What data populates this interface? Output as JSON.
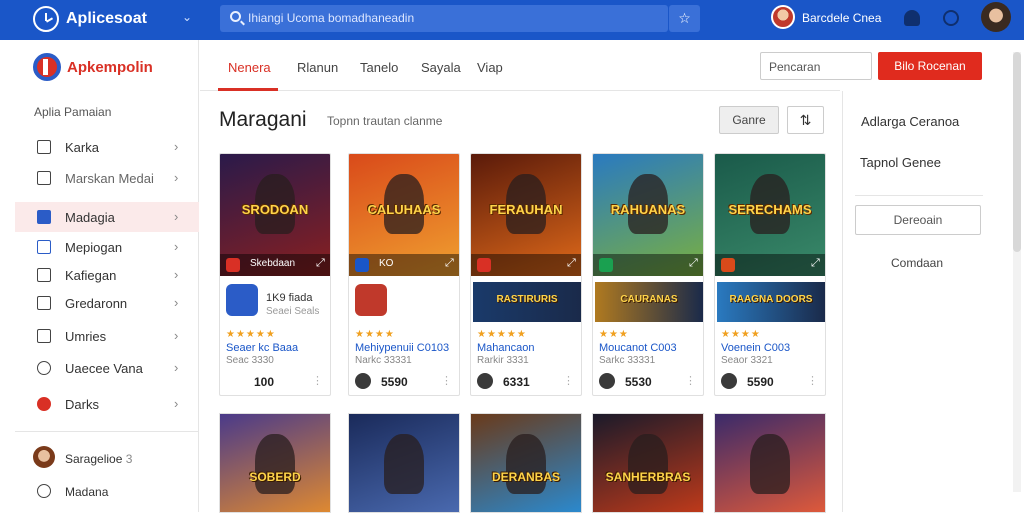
{
  "topbar": {
    "app_title": "Aplicesoat",
    "search_placeholder": "Ihiangi Ucoma bomadhaneadin",
    "user_name": "Barcdele Cnea"
  },
  "sidebar": {
    "brand": "Apkempolin",
    "section_title": "Aplia Pamaian",
    "items": [
      {
        "label": "Karka",
        "icon": "document-icon"
      },
      {
        "label": "Marskan Medai",
        "icon": "square-icon"
      },
      {
        "label": "Madagia",
        "icon": "star-icon",
        "active": true
      },
      {
        "label": "Mepiogan",
        "icon": "list-icon"
      },
      {
        "label": "Kafiegan",
        "icon": "square-icon"
      },
      {
        "label": "Gredaronn",
        "icon": "folder-icon"
      },
      {
        "label": "Umries",
        "icon": "chart-icon"
      },
      {
        "label": "Uaecee Vana",
        "icon": "refresh-icon"
      },
      {
        "label": "Darks",
        "icon": "flag-icon"
      }
    ],
    "user": "Saragelioe",
    "user_badge": "3",
    "last_item": "Madana"
  },
  "tabs": [
    "Nenera",
    "Rlanun",
    "Tanelo",
    "Sayala",
    "Viap"
  ],
  "tab_search_placeholder": "Pencaran",
  "primary_button": "Bilo Rocenan",
  "main": {
    "title": "Maragani",
    "subtitle": "Topnn trautan clanme",
    "genre_button": "Ganre",
    "filter_icon": "sort-icon"
  },
  "cards": [
    {
      "art_title": "SRODOAN",
      "foot_text": "Skebdaan",
      "mini_color": "#d93025",
      "t1": "1K9 fiada",
      "t2": "Seaei Seals",
      "stars": "★★★★★",
      "title": "Seaer kc Baaa",
      "sub": "Seac 3330",
      "price": "100",
      "art_colors": [
        "#2a1a4a",
        "#8a2020"
      ],
      "thumb_color": "#2b5cc7"
    },
    {
      "art_title": "CALUHAAS",
      "foot_text": "KO",
      "mini_color": "#1a56c8",
      "t1": "",
      "t2": "",
      "stars": "★★★★",
      "title": "Mehiypenuii C0103",
      "sub": "Narkc 33331",
      "price": "5590",
      "art_colors": [
        "#d94a1a",
        "#f0a030"
      ],
      "thumb_color": "#c0392b"
    },
    {
      "art_title": "FERAUHAN",
      "foot_text": "",
      "mini_color": "#d93025",
      "banner": "RASTIRURIS",
      "stars": "★★★★★",
      "title": "Mahancaon",
      "sub": "Rarkir 3331",
      "price": "6331",
      "art_colors": [
        "#5a1a0a",
        "#e06a1a"
      ],
      "thumb_color": "#1a3a6a"
    },
    {
      "art_title": "RAHUANAS",
      "foot_text": "",
      "mini_color": "#1aa050",
      "banner": "CAURANAS",
      "stars": "★★★",
      "title": "Moucanot C003",
      "sub": "Sarkc 33331",
      "price": "5530",
      "art_colors": [
        "#2a7ac0",
        "#7ab040"
      ],
      "thumb_color": "#b07a20"
    },
    {
      "art_title": "SERECHAMS",
      "foot_text": "",
      "mini_color": "#d94a1a",
      "banner": "RAAGNA DOORS",
      "stars": "★★★★",
      "title": "Voenein C003",
      "sub": "Seaor 3321",
      "price": "5590",
      "art_colors": [
        "#1a5a4a",
        "#3a8a6a"
      ],
      "thumb_color": "#2a7ac0"
    }
  ],
  "cards_row2": [
    {
      "art_title": "SOBERD",
      "art_colors": [
        "#4a3a8a",
        "#e08a30"
      ]
    },
    {
      "art_title": "",
      "art_colors": [
        "#1a2a5a",
        "#4a6ab0"
      ]
    },
    {
      "art_title": "DERANBAS",
      "art_colors": [
        "#6a3a1a",
        "#2a8ad0"
      ]
    },
    {
      "art_title": "SANHERBRAS",
      "art_colors": [
        "#1a1a2a",
        "#c03a1a"
      ]
    },
    {
      "art_title": "",
      "art_colors": [
        "#3a2a6a",
        "#e05a3a"
      ]
    }
  ],
  "rpanel": {
    "item1": "Adlarga Ceranoa",
    "item2": "Tapnol Genee",
    "button": "Dereoain",
    "item3": "Comdaan"
  }
}
